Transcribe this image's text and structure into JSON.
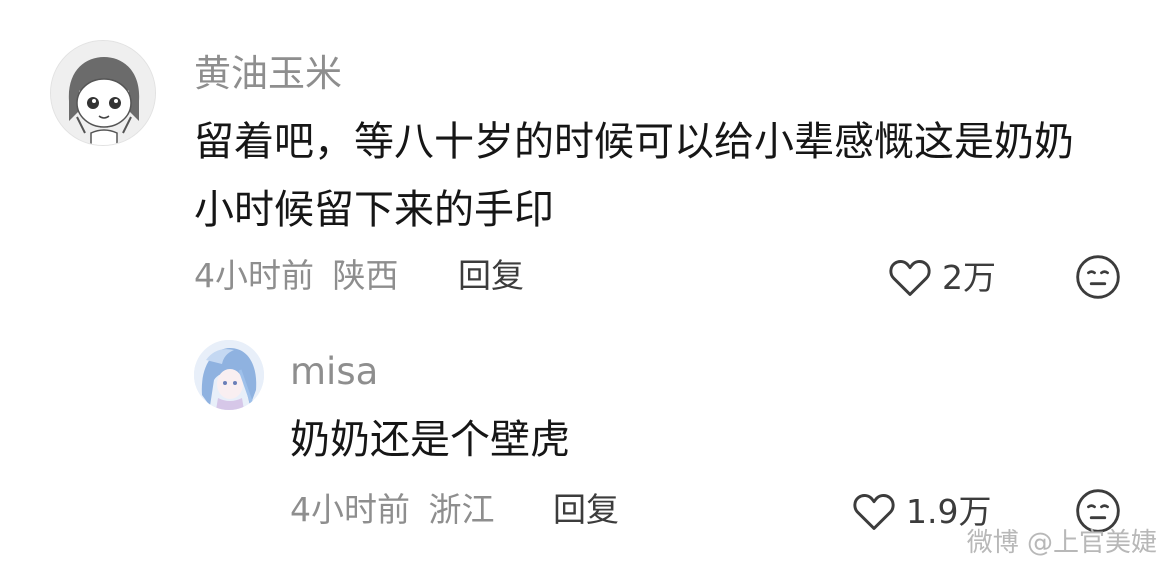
{
  "comments": [
    {
      "username": "黄油玉米",
      "text_line1": "留着吧，等八十岁的时候可以给小辈感慨这是奶奶",
      "text_line2": "小时候留下来的手印",
      "time": "4小时前",
      "location": "陕西",
      "reply_label": "回复",
      "likes": "2万",
      "avatar_icon": "cartoon-girl-avatar"
    },
    {
      "username": "misa",
      "text": "奶奶还是个壁虎",
      "time": "4小时前",
      "location": "浙江",
      "reply_label": "回复",
      "likes": "1.9万",
      "avatar_icon": "anime-girl-avatar"
    }
  ],
  "icons": {
    "like": "heart-outline-icon",
    "reaction": "neutral-face-icon"
  },
  "watermark": "微博 @上官美婕",
  "colors": {
    "username": "#8e8e8e",
    "text": "#161616",
    "meta": "#8e8e8e",
    "action": "#3c3c3c",
    "background": "#ffffff"
  }
}
